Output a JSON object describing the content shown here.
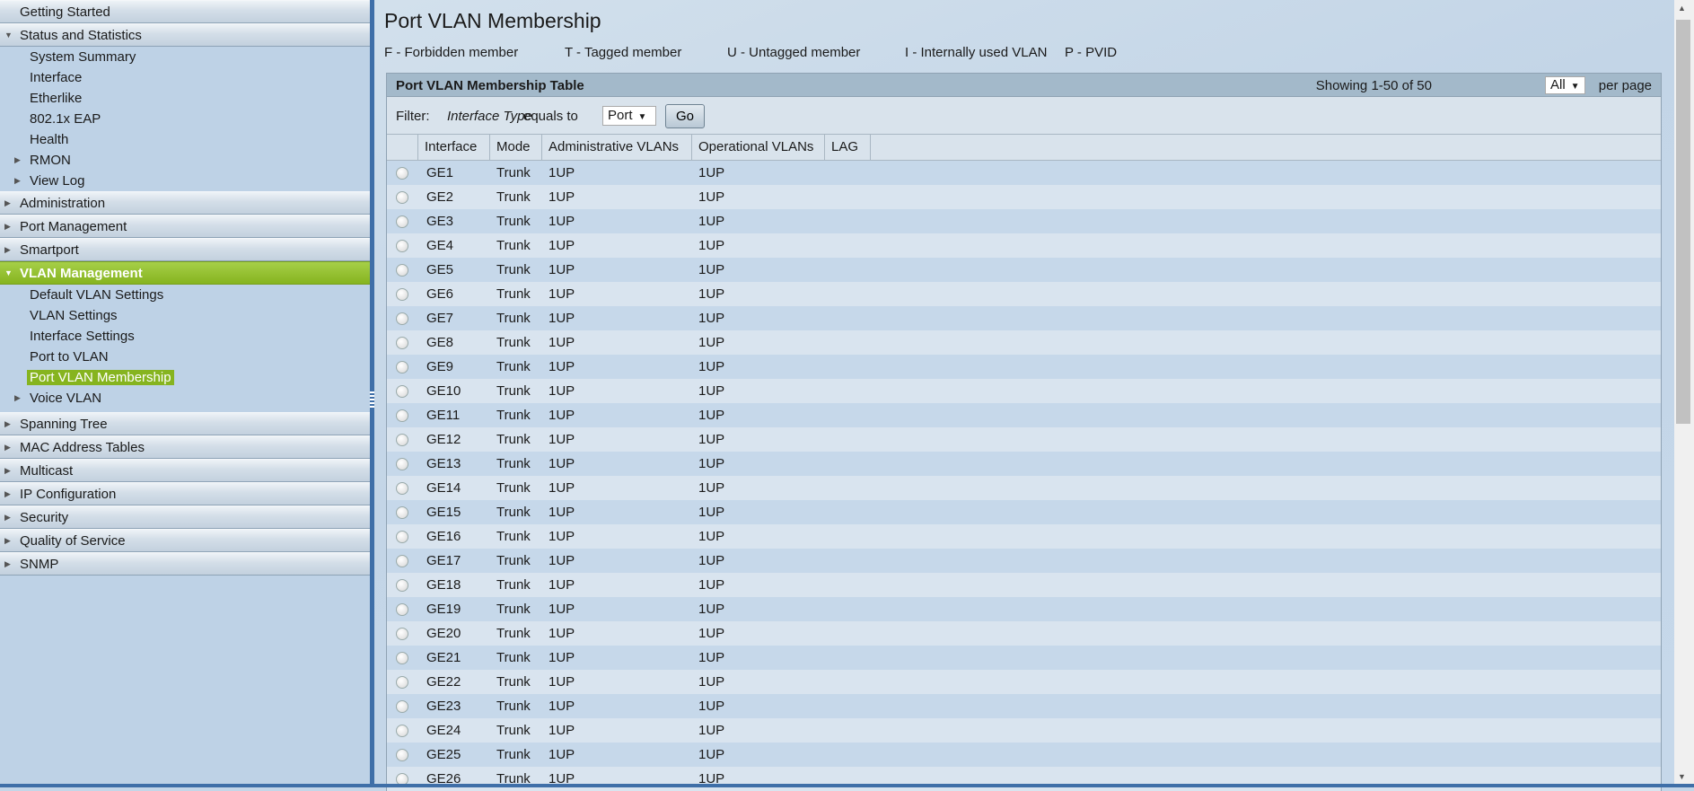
{
  "sidebar": {
    "getting_started": "Getting Started",
    "status": "Status and Statistics",
    "status_items": [
      "System Summary",
      "Interface",
      "Etherlike",
      "802.1x EAP",
      "Health",
      "RMON",
      "View Log"
    ],
    "administration": "Administration",
    "port_management": "Port Management",
    "smartport": "Smartport",
    "vlan": "VLAN Management",
    "vlan_items": [
      "Default VLAN Settings",
      "VLAN Settings",
      "Interface Settings",
      "Port to VLAN",
      "Port VLAN Membership",
      "Voice VLAN"
    ],
    "rest": [
      "Spanning Tree",
      "MAC Address Tables",
      "Multicast",
      "IP Configuration",
      "Security",
      "Quality of Service",
      "SNMP"
    ]
  },
  "page": {
    "title": "Port VLAN Membership",
    "legend": [
      "F - Forbidden member",
      "T - Tagged member",
      "U - Untagged member",
      "I - Internally used VLAN",
      "P - PVID"
    ]
  },
  "table": {
    "title": "Port VLAN Membership Table",
    "showing": "Showing 1-50 of 50",
    "per_page_value": "All",
    "per_page_label": "per page",
    "filter_label": "Filter:",
    "filter_field": "Interface Type",
    "filter_op": "equals to",
    "filter_value": "Port",
    "go": "Go",
    "columns": [
      "Interface",
      "Mode",
      "Administrative VLANs",
      "Operational VLANs",
      "LAG"
    ],
    "rows": [
      [
        "GE1",
        "Trunk",
        "1UP",
        "1UP",
        ""
      ],
      [
        "GE2",
        "Trunk",
        "1UP",
        "1UP",
        ""
      ],
      [
        "GE3",
        "Trunk",
        "1UP",
        "1UP",
        ""
      ],
      [
        "GE4",
        "Trunk",
        "1UP",
        "1UP",
        ""
      ],
      [
        "GE5",
        "Trunk",
        "1UP",
        "1UP",
        ""
      ],
      [
        "GE6",
        "Trunk",
        "1UP",
        "1UP",
        ""
      ],
      [
        "GE7",
        "Trunk",
        "1UP",
        "1UP",
        ""
      ],
      [
        "GE8",
        "Trunk",
        "1UP",
        "1UP",
        ""
      ],
      [
        "GE9",
        "Trunk",
        "1UP",
        "1UP",
        ""
      ],
      [
        "GE10",
        "Trunk",
        "1UP",
        "1UP",
        ""
      ],
      [
        "GE11",
        "Trunk",
        "1UP",
        "1UP",
        ""
      ],
      [
        "GE12",
        "Trunk",
        "1UP",
        "1UP",
        ""
      ],
      [
        "GE13",
        "Trunk",
        "1UP",
        "1UP",
        ""
      ],
      [
        "GE14",
        "Trunk",
        "1UP",
        "1UP",
        ""
      ],
      [
        "GE15",
        "Trunk",
        "1UP",
        "1UP",
        ""
      ],
      [
        "GE16",
        "Trunk",
        "1UP",
        "1UP",
        ""
      ],
      [
        "GE17",
        "Trunk",
        "1UP",
        "1UP",
        ""
      ],
      [
        "GE18",
        "Trunk",
        "1UP",
        "1UP",
        ""
      ],
      [
        "GE19",
        "Trunk",
        "1UP",
        "1UP",
        ""
      ],
      [
        "GE20",
        "Trunk",
        "1UP",
        "1UP",
        ""
      ],
      [
        "GE21",
        "Trunk",
        "1UP",
        "1UP",
        ""
      ],
      [
        "GE22",
        "Trunk",
        "1UP",
        "1UP",
        ""
      ],
      [
        "GE23",
        "Trunk",
        "1UP",
        "1UP",
        ""
      ],
      [
        "GE24",
        "Trunk",
        "1UP",
        "1UP",
        ""
      ],
      [
        "GE25",
        "Trunk",
        "1UP",
        "1UP",
        ""
      ],
      [
        "GE26",
        "Trunk",
        "1UP",
        "1UP",
        ""
      ]
    ]
  }
}
